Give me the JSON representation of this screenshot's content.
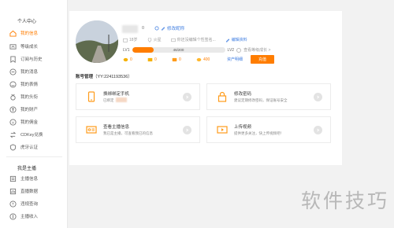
{
  "sidebar": {
    "group1_title": "个人中心",
    "items": [
      {
        "label": "我的信息",
        "icon": "home-icon",
        "active": true
      },
      {
        "label": "等级成长",
        "icon": "level-icon",
        "active": false
      },
      {
        "label": "订阅与历史",
        "icon": "bookmark-icon",
        "active": false
      },
      {
        "label": "我的消息",
        "icon": "message-icon",
        "active": false
      },
      {
        "label": "我的表情",
        "icon": "emoji-icon",
        "active": false
      },
      {
        "label": "我的头衔",
        "icon": "medal-icon",
        "active": false
      },
      {
        "label": "我的财产",
        "icon": "wallet-icon",
        "active": false
      },
      {
        "label": "我的佣金",
        "icon": "coin-icon",
        "active": false
      },
      {
        "label": "CDKey兑换",
        "icon": "exchange-icon",
        "active": false
      },
      {
        "label": "虎牙认证",
        "icon": "shield-icon",
        "active": false
      }
    ],
    "group2_title": "我是主播",
    "items2": [
      {
        "label": "主播信息",
        "icon": "list-icon"
      },
      {
        "label": "直播数据",
        "icon": "chart-icon"
      },
      {
        "label": "违规查询",
        "icon": "alert-icon"
      },
      {
        "label": "主播收入",
        "icon": "income-icon"
      }
    ]
  },
  "profile": {
    "uid_count": "0",
    "edit_label": "修改昵称",
    "gender": "18岁",
    "location": "火星",
    "signature": "你还没编辑个性签名...",
    "edit_profile": "编辑资料",
    "level_from": "LV1",
    "level_to": "LV2",
    "level_progress_text": "46/200",
    "level_progress": 0.23,
    "level_hint": "查看等级成长 >",
    "assets": [
      {
        "icon": "gold-bean-icon",
        "value": "0"
      },
      {
        "icon": "silver-bean-icon",
        "value": "0"
      },
      {
        "icon": "ticket-icon",
        "value": "0"
      },
      {
        "icon": "bean-icon",
        "value": "400"
      }
    ],
    "invite_label": "资产明细",
    "charge_label": "充值"
  },
  "account": {
    "title": "账号管理",
    "yy": "（YY:2241193536）",
    "cards": [
      {
        "title": "换绑绑定手机",
        "sub": "已绑定",
        "icon": "phone-icon"
      },
      {
        "title": "修改密码",
        "sub": "建议定期修改密码，保证账号安全",
        "icon": "lock-icon"
      },
      {
        "title": "查看主播信息",
        "sub": "我已是主播，可查看我已的信息",
        "icon": "id-card-icon"
      },
      {
        "title": "上传视频",
        "sub": "提供更多关注，快上传视频吧！",
        "icon": "video-icon"
      }
    ]
  },
  "watermark": "软件技巧",
  "colors": {
    "accent": "#ff7d00",
    "link": "#3b7be0"
  }
}
